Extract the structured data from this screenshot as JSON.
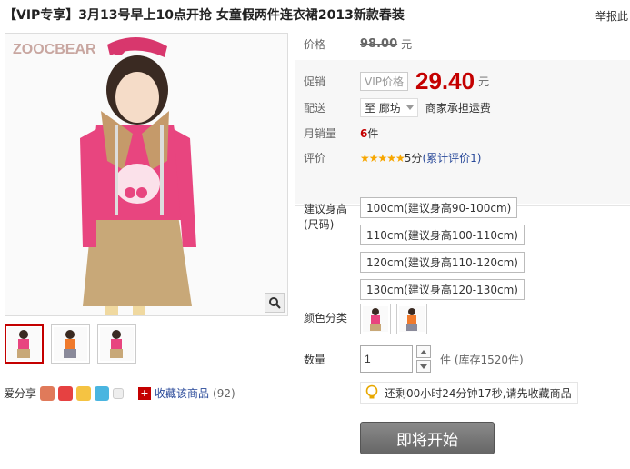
{
  "header": {
    "title": "【VIP专享】3月13号早上10点开抢 女童假两件连衣裙2013新款春装",
    "report_label": "举报此"
  },
  "gallery": {
    "watermark": "ZOOCBEAR",
    "zoom_icon": "magnifier-icon",
    "thumbnails": [
      "pink",
      "orange",
      "pink"
    ]
  },
  "share": {
    "label": "爱分享",
    "favorite_label": "收藏该商品",
    "favorite_count": "(92)"
  },
  "price": {
    "label": "价格",
    "original": "98.00",
    "unit": "元"
  },
  "promo": {
    "label": "促销",
    "tag": "VIP价格",
    "price": "29.40",
    "unit": "元"
  },
  "delivery": {
    "label": "配送",
    "location": "至 廊坊",
    "note": "商家承担运费"
  },
  "sales": {
    "label": "月销量",
    "count": "6",
    "unit": "件"
  },
  "review": {
    "label": "评价",
    "stars": "★★★★★",
    "score": "5分",
    "link": "(累计评价1)"
  },
  "size": {
    "label": "建议身高\n(尺码)",
    "options": [
      "100cm(建议身高90-100cm)",
      "110cm(建议身高100-110cm)",
      "120cm(建议身高110-120cm)",
      "130cm(建议身高120-130cm)"
    ]
  },
  "color": {
    "label": "颜色分类"
  },
  "quantity": {
    "label": "数量",
    "value": "1",
    "stock": "件  (库存1520件)"
  },
  "countdown": {
    "text": "还剩00小时24分钟17秒,请先收藏商品"
  },
  "buy": {
    "label": "即将开始"
  },
  "colors": {
    "price_red": "#c40000",
    "link_blue": "#2a4a9a",
    "pink": "#e8457f",
    "khaki": "#c8a878",
    "orange": "#f07a2c"
  }
}
